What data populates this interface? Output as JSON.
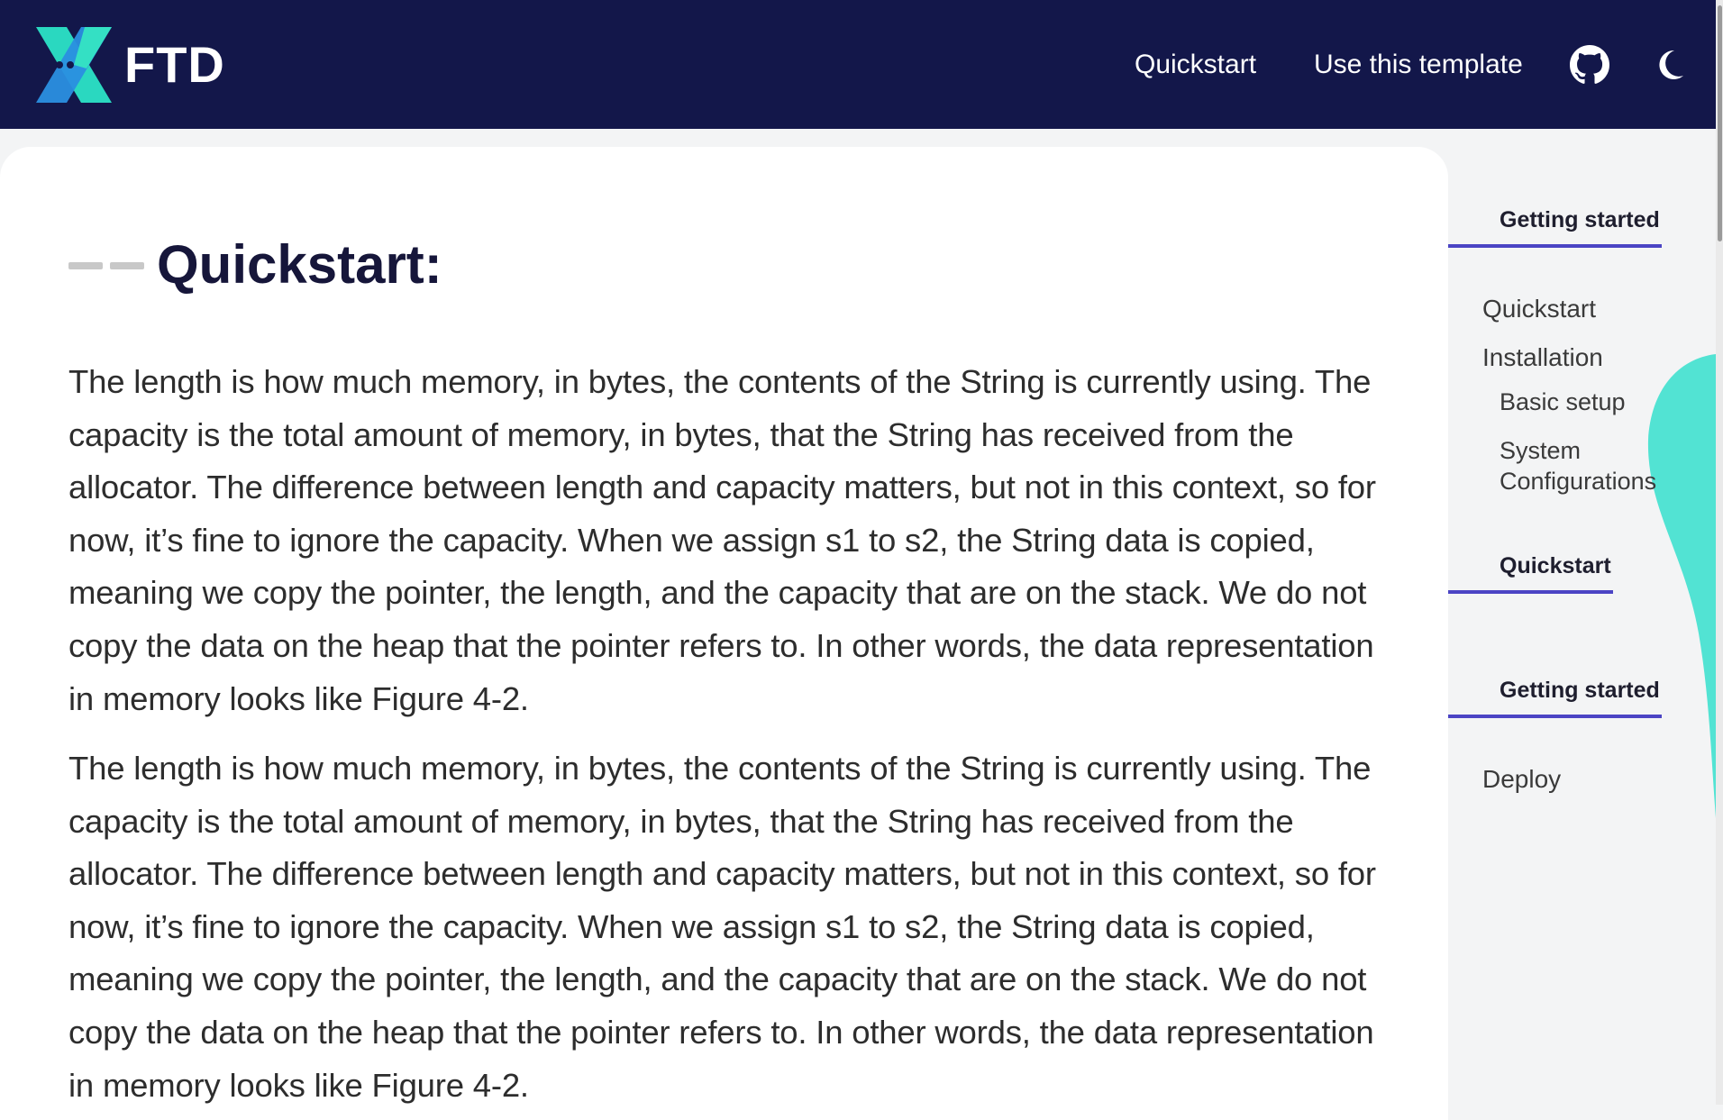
{
  "header": {
    "brand": "FTD",
    "nav": [
      "Quickstart",
      "Use this template"
    ],
    "icons": [
      "github-icon",
      "moon-icon"
    ],
    "colors": {
      "background": "#13174a",
      "logo_primary": "#2ad8c0",
      "logo_secondary": "#2a8fe0"
    }
  },
  "main": {
    "title": "Quickstart",
    "title_colon": ":",
    "paragraphs": [
      "The length is how much memory, in bytes, the contents of the String is currently using. The capacity is the total amount of memory, in bytes, that the String has received from the allocator. The difference between length and capacity matters, but not in this context, so for now, it’s fine to ignore the capacity. When we assign s1 to s2, the String data is copied, meaning we copy the pointer, the length, and the capacity that are on the stack. We do not copy the data on the heap that the pointer refers to. In other words, the data representation in memory looks like Figure 4-2.",
      "The length is how much memory, in bytes, the contents of the String is currently using. The capacity is the total amount of memory, in bytes, that the String has received from the allocator. The difference between length and capacity matters, but not in this context, so for now, it’s fine to ignore the capacity. When we assign s1 to s2, the String data is copied, meaning we copy the pointer, the length, and the capacity that are on the stack. We do not copy the data on the heap that the pointer refers to. In other words, the data representation in memory looks like Figure 4-2."
    ]
  },
  "toc": {
    "sections": [
      {
        "title": "Getting started",
        "items": [
          "Quickstart",
          "Installation"
        ],
        "subitems": [
          "Basic setup",
          "System",
          "Configurations"
        ]
      },
      {
        "title": "Quickstart",
        "items": []
      },
      {
        "title": "Getting started",
        "items": [
          "Deploy"
        ]
      }
    ],
    "accent_color": "#4b44c4",
    "blob_color": "#52e3d3"
  }
}
